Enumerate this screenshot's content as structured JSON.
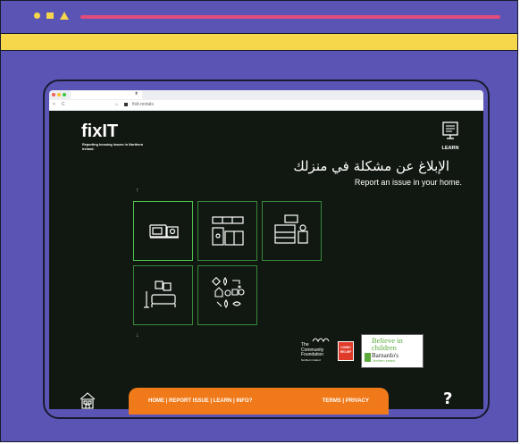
{
  "browser": {
    "tab_title": "",
    "tab_close": "×",
    "new_tab": "+",
    "url": "fixit.rentals",
    "back": "<",
    "reload": "C",
    "home": "⌂"
  },
  "site": {
    "logo": "fixIT",
    "tagline": "Reporting housing issues in Northern Ireland.",
    "learn_label": "LEARN",
    "arabic_heading": "الإبلاغ عن مشكلة في منزلك",
    "subheading": "Report an issue in your home.",
    "arrow_up": "↑",
    "arrow_down": "↓",
    "tiles": [
      {
        "icon": "kitchen-appliances-icon"
      },
      {
        "icon": "kitchen-cabinets-icon"
      },
      {
        "icon": "bedroom-icon"
      },
      {
        "icon": "living-room-icon"
      },
      {
        "icon": "utilities-icon"
      }
    ],
    "partners": {
      "community_foundation": [
        "The",
        "Community",
        "Foundation",
        "Northern Ireland"
      ],
      "comic_relief": "COMIC RELIEF",
      "barnardos_line1": "Believe in",
      "barnardos_line2": "children",
      "barnardos_line3": "Barnardo's",
      "barnardos_line4": "Northern Ireland"
    },
    "footer": {
      "nav": "HOME  |  REPORT ISSUE  |  LEARN  |  INFO?",
      "legal": "TERMS  |  PRIVACY"
    },
    "help": "?"
  },
  "colors": {
    "frame_bg": "#5a55b5",
    "accent_yellow": "#f6d64a",
    "accent_pink": "#e14d7a",
    "site_bg": "#111811",
    "tile_border": "#3a8a3a",
    "footer_orange": "#f07a1a"
  }
}
